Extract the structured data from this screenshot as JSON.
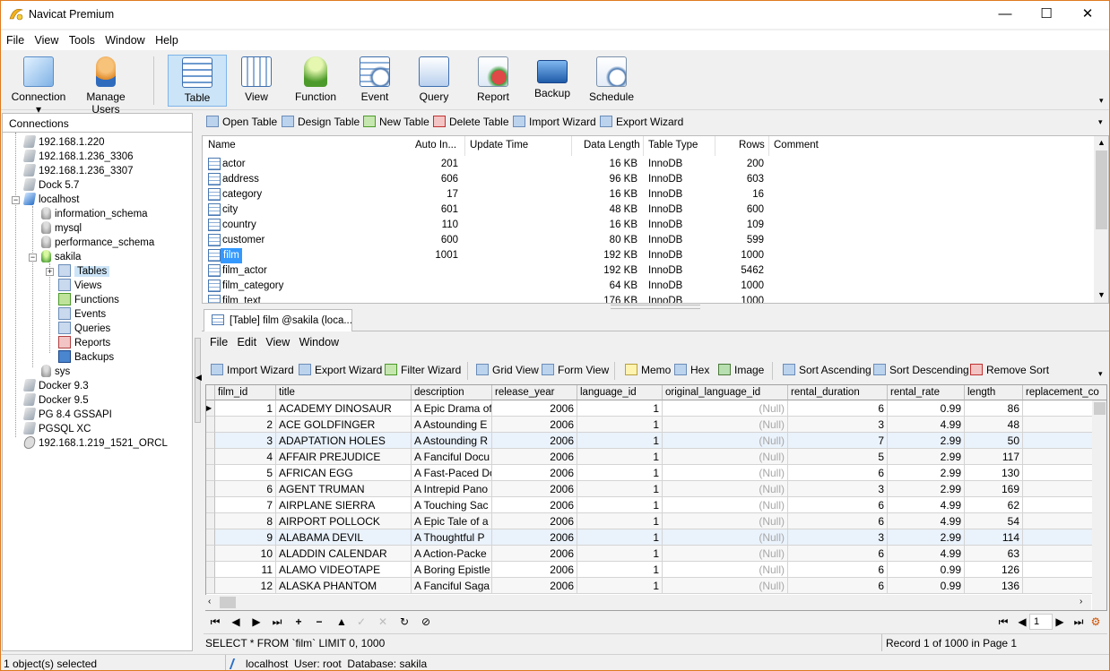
{
  "app": {
    "title": "Navicat Premium"
  },
  "window_controls": {
    "minimize": "—",
    "maximize": "☐",
    "close": "✕"
  },
  "menu": [
    "File",
    "View",
    "Tools",
    "Window",
    "Help"
  ],
  "toolbar": {
    "connection": "Connection",
    "manage_users": "Manage Users",
    "items": [
      "Table",
      "View",
      "Function",
      "Event",
      "Query",
      "Report",
      "Backup",
      "Schedule"
    ]
  },
  "connections": {
    "header": "Connections",
    "nodes": [
      "192.168.1.220",
      "192.168.1.236_3306",
      "192.168.1.236_3307",
      "Dock 5.7",
      "localhost",
      "information_schema",
      "mysql",
      "performance_schema",
      "sakila",
      "Tables",
      "Views",
      "Functions",
      "Events",
      "Queries",
      "Reports",
      "Backups",
      "sys",
      "Docker 9.3",
      "Docker 9.5",
      "PG 8.4 GSSAPI",
      "PGSQL XC",
      "192.168.1.219_1521_ORCL"
    ]
  },
  "object_toolbar": [
    "Open Table",
    "Design Table",
    "New Table",
    "Delete Table",
    "Import Wizard",
    "Export Wizard"
  ],
  "tables_list": {
    "columns": [
      "Name",
      "Auto In...",
      "Update Time",
      "Data Length",
      "Table Type",
      "Rows",
      "Comment"
    ],
    "rows": [
      [
        "actor",
        "201",
        "",
        "16 KB",
        "InnoDB",
        "200"
      ],
      [
        "address",
        "606",
        "",
        "96 KB",
        "InnoDB",
        "603"
      ],
      [
        "category",
        "17",
        "",
        "16 KB",
        "InnoDB",
        "16"
      ],
      [
        "city",
        "601",
        "",
        "48 KB",
        "InnoDB",
        "600"
      ],
      [
        "country",
        "110",
        "",
        "16 KB",
        "InnoDB",
        "109"
      ],
      [
        "customer",
        "600",
        "",
        "80 KB",
        "InnoDB",
        "599"
      ],
      [
        "film",
        "1001",
        "",
        "192 KB",
        "InnoDB",
        "1000"
      ],
      [
        "film_actor",
        "",
        "",
        "192 KB",
        "InnoDB",
        "5462"
      ],
      [
        "film_category",
        "",
        "",
        "64 KB",
        "InnoDB",
        "1000"
      ],
      [
        "film_text",
        "",
        "",
        "176 KB",
        "InnoDB",
        "1000"
      ]
    ]
  },
  "tab": {
    "label": "[Table] film @sakila (loca..."
  },
  "inner_menu": [
    "File",
    "Edit",
    "View",
    "Window"
  ],
  "inner_toolbar": [
    "Import Wizard",
    "Export Wizard",
    "Filter Wizard",
    "Grid View",
    "Form View",
    "Memo",
    "Hex",
    "Image",
    "Sort Ascending",
    "Sort Descending",
    "Remove Sort"
  ],
  "grid": {
    "columns": [
      "film_id",
      "title",
      "description",
      "release_year",
      "language_id",
      "original_language_id",
      "rental_duration",
      "rental_rate",
      "length",
      "replacement_co"
    ],
    "rows": [
      [
        "1",
        "ACADEMY DINOSAUR",
        "A Epic Drama of",
        "2006",
        "1",
        "(Null)",
        "6",
        "0.99",
        "86"
      ],
      [
        "2",
        "ACE GOLDFINGER",
        "A Astounding E",
        "2006",
        "1",
        "(Null)",
        "3",
        "4.99",
        "48"
      ],
      [
        "3",
        "ADAPTATION HOLES",
        "A Astounding R",
        "2006",
        "1",
        "(Null)",
        "7",
        "2.99",
        "50"
      ],
      [
        "4",
        "AFFAIR PREJUDICE",
        "A Fanciful Docu",
        "2006",
        "1",
        "(Null)",
        "5",
        "2.99",
        "117"
      ],
      [
        "5",
        "AFRICAN EGG",
        "A Fast-Paced Do",
        "2006",
        "1",
        "(Null)",
        "6",
        "2.99",
        "130"
      ],
      [
        "6",
        "AGENT TRUMAN",
        "A Intrepid Pano",
        "2006",
        "1",
        "(Null)",
        "3",
        "2.99",
        "169"
      ],
      [
        "7",
        "AIRPLANE SIERRA",
        "A Touching Sac",
        "2006",
        "1",
        "(Null)",
        "6",
        "4.99",
        "62"
      ],
      [
        "8",
        "AIRPORT POLLOCK",
        "A Epic Tale of a",
        "2006",
        "1",
        "(Null)",
        "6",
        "4.99",
        "54"
      ],
      [
        "9",
        "ALABAMA DEVIL",
        "A Thoughtful P",
        "2006",
        "1",
        "(Null)",
        "3",
        "2.99",
        "114"
      ],
      [
        "10",
        "ALADDIN CALENDAR",
        "A Action-Packe",
        "2006",
        "1",
        "(Null)",
        "6",
        "4.99",
        "63"
      ],
      [
        "11",
        "ALAMO VIDEOTAPE",
        "A Boring Epistle",
        "2006",
        "1",
        "(Null)",
        "6",
        "0.99",
        "126"
      ],
      [
        "12",
        "ALASKA PHANTOM",
        "A Fanciful Saga",
        "2006",
        "1",
        "(Null)",
        "6",
        "0.99",
        "136"
      ]
    ]
  },
  "navbar": {
    "page": "1"
  },
  "sql": "SELECT * FROM `film` LIMIT 0, 1000",
  "record_info": "Record 1 of 1000 in Page 1",
  "status": {
    "selected": "1 object(s) selected",
    "connection": "localhost",
    "user": "User: root",
    "database": "Database: sakila"
  }
}
